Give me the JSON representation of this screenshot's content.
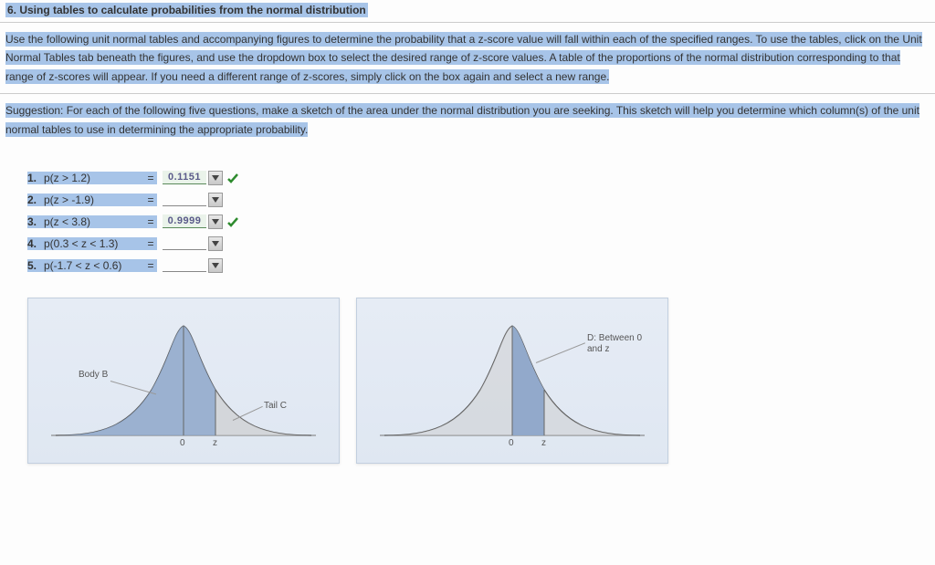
{
  "title": "6. Using tables to calculate probabilities from the normal distribution",
  "para1": "Use the following unit normal tables and accompanying figures to determine the probability that a z-score value will fall within each of the specified ranges. To use the tables, click on the Unit Normal Tables tab beneath the figures, and use the dropdown box to select the desired range of z-score values. A table of the proportions of the normal distribution corresponding to that range of z-scores will appear. If you need a different range of z-scores, simply click on the box again and select a new range.",
  "para2": "Suggestion: For each of the following five questions, make a sketch of the area under the normal distribution you are seeking. This sketch will help you determine which column(s) of the unit normal tables to use in determining the appropriate probability.",
  "questions": [
    {
      "num": "1.",
      "label": "p(z > 1.2)",
      "value": "0.1151",
      "correct": true
    },
    {
      "num": "2.",
      "label": "p(z > -1.9)",
      "value": "",
      "correct": false
    },
    {
      "num": "3.",
      "label": "p(z < 3.8)",
      "value": "0.9999",
      "correct": true
    },
    {
      "num": "4.",
      "label": "p(0.3 < z < 1.3)",
      "value": "",
      "correct": false
    },
    {
      "num": "5.",
      "label": "p(-1.7 < z < 0.6)",
      "value": "",
      "correct": false
    }
  ],
  "fig1": {
    "body_label": "Body B",
    "tail_label": "Tail C",
    "zero": "0",
    "z": "z"
  },
  "fig2": {
    "between_label_l1": "D: Between 0",
    "between_label_l2": "and z",
    "zero": "0",
    "z": "z"
  },
  "chart_data": [
    {
      "type": "area",
      "title": "Normal distribution: Body B (left of z) and Tail C (right of z)",
      "xlabel": "",
      "ylabel": "",
      "x_markers": [
        "0",
        "z"
      ],
      "regions": [
        {
          "name": "Body B",
          "range": "(-inf, z)"
        },
        {
          "name": "Tail C",
          "range": "(z, +inf)"
        }
      ],
      "curve": "standard normal pdf, z marker to the right of 0"
    },
    {
      "type": "area",
      "title": "Normal distribution: D, area between 0 and z",
      "xlabel": "",
      "ylabel": "",
      "x_markers": [
        "0",
        "z"
      ],
      "regions": [
        {
          "name": "D: Between 0 and z",
          "range": "(0, z)"
        }
      ],
      "curve": "standard normal pdf, z marker to the right of 0"
    }
  ]
}
